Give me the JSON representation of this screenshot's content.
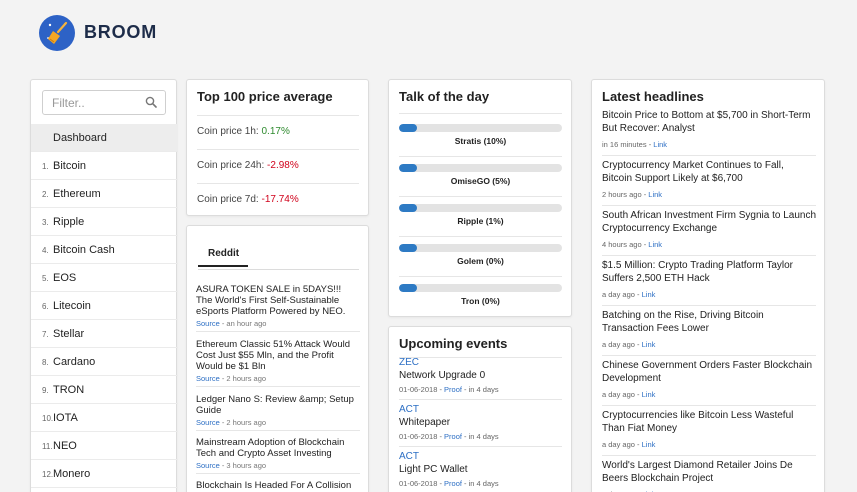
{
  "brand": {
    "name": "BROOM"
  },
  "sidebar": {
    "filter_placeholder": "Filter..",
    "items": [
      {
        "num": "",
        "label": "Dashboard",
        "active": true
      },
      {
        "num": "1.",
        "label": "Bitcoin"
      },
      {
        "num": "2.",
        "label": "Ethereum"
      },
      {
        "num": "3.",
        "label": "Ripple"
      },
      {
        "num": "4.",
        "label": "Bitcoin Cash"
      },
      {
        "num": "5.",
        "label": "EOS"
      },
      {
        "num": "6.",
        "label": "Litecoin"
      },
      {
        "num": "7.",
        "label": "Stellar"
      },
      {
        "num": "8.",
        "label": "Cardano"
      },
      {
        "num": "9.",
        "label": "TRON"
      },
      {
        "num": "10.",
        "label": "IOTA"
      },
      {
        "num": "11.",
        "label": "NEO"
      },
      {
        "num": "12.",
        "label": "Monero"
      }
    ]
  },
  "price_avg": {
    "title": "Top 100 price average",
    "rows": [
      {
        "label": "Coin price 1h:",
        "value": "0.17%",
        "positive": true
      },
      {
        "label": "Coin price 24h:",
        "value": "-2.98%",
        "positive": false
      },
      {
        "label": "Coin price 7d:",
        "value": "-17.74%",
        "positive": false
      }
    ]
  },
  "reddit": {
    "tab": "Reddit",
    "posts": [
      {
        "title": "ASURA TOKEN SALE in 5DAYS!!! The World's First Self-Sustainable eSports Platform Powered by NEO.",
        "source": "Source",
        "time": " - an hour ago"
      },
      {
        "title": "Ethereum Classic 51% Attack Would Cost Just $55 Mln, and the Profit Would be $1 Bln",
        "source": "Source",
        "time": " - 2 hours ago"
      },
      {
        "title": "Ledger Nano S: Review &amp; Setup Guide",
        "source": "Source",
        "time": " - 2 hours ago"
      },
      {
        "title": "Mainstream Adoption of Blockchain Tech and Crypto Asset Investing",
        "source": "Source",
        "time": " - 3 hours ago"
      },
      {
        "title": "Blockchain Is Headed For A Collision",
        "source": "",
        "time": ""
      }
    ]
  },
  "talk": {
    "title": "Talk of the day",
    "items": [
      {
        "label": "Stratis (10%)",
        "percent": 10
      },
      {
        "label": "OmiseGO (5%)",
        "percent": 5
      },
      {
        "label": "Ripple (1%)",
        "percent": 1
      },
      {
        "label": "Golem (0%)",
        "percent": 0
      },
      {
        "label": "Tron (0%)",
        "percent": 0
      }
    ]
  },
  "events": {
    "title": "Upcoming events",
    "items": [
      {
        "symbol": "ZEC",
        "name": "Network Upgrade 0",
        "date": "01-06-2018 - ",
        "proof": "Proof",
        "when": " - in 4 days"
      },
      {
        "symbol": "ACT",
        "name": "Whitepaper",
        "date": "01-06-2018 - ",
        "proof": "Proof",
        "when": " - in 4 days"
      },
      {
        "symbol": "ACT",
        "name": "Light PC Wallet",
        "date": "01-06-2018 - ",
        "proof": "Proof",
        "when": " - in 4 days"
      }
    ]
  },
  "headlines": {
    "title": "Latest headlines",
    "items": [
      {
        "title": "Bitcoin Price to Bottom at $5,700 in Short-Term But Recover: Analyst",
        "time": "in 16 minutes - ",
        "link": "Link"
      },
      {
        "title": "Cryptocurrency Market Continues to Fall, Bitcoin Support Likely at $6,700",
        "time": "2 hours ago - ",
        "link": "Link"
      },
      {
        "title": "South African Investment Firm Sygnia to Launch Cryptocurrency Exchange",
        "time": "4 hours ago - ",
        "link": "Link"
      },
      {
        "title": "$1.5 Million: Crypto Trading Platform Taylor Suffers 2,500 ETH Hack",
        "time": "a day ago - ",
        "link": "Link"
      },
      {
        "title": "Batching on the Rise, Driving Bitcoin Transaction Fees Lower",
        "time": "a day ago - ",
        "link": "Link"
      },
      {
        "title": "Chinese Government Orders Faster Blockchain Development",
        "time": "a day ago - ",
        "link": "Link"
      },
      {
        "title": "Cryptocurrencies like Bitcoin Less Wasteful Than Fiat Money",
        "time": "a day ago - ",
        "link": "Link"
      },
      {
        "title": "World's Largest Diamond Retailer Joins De Beers Blockchain Project",
        "time": "a day ago - ",
        "link": "Link"
      }
    ]
  }
}
